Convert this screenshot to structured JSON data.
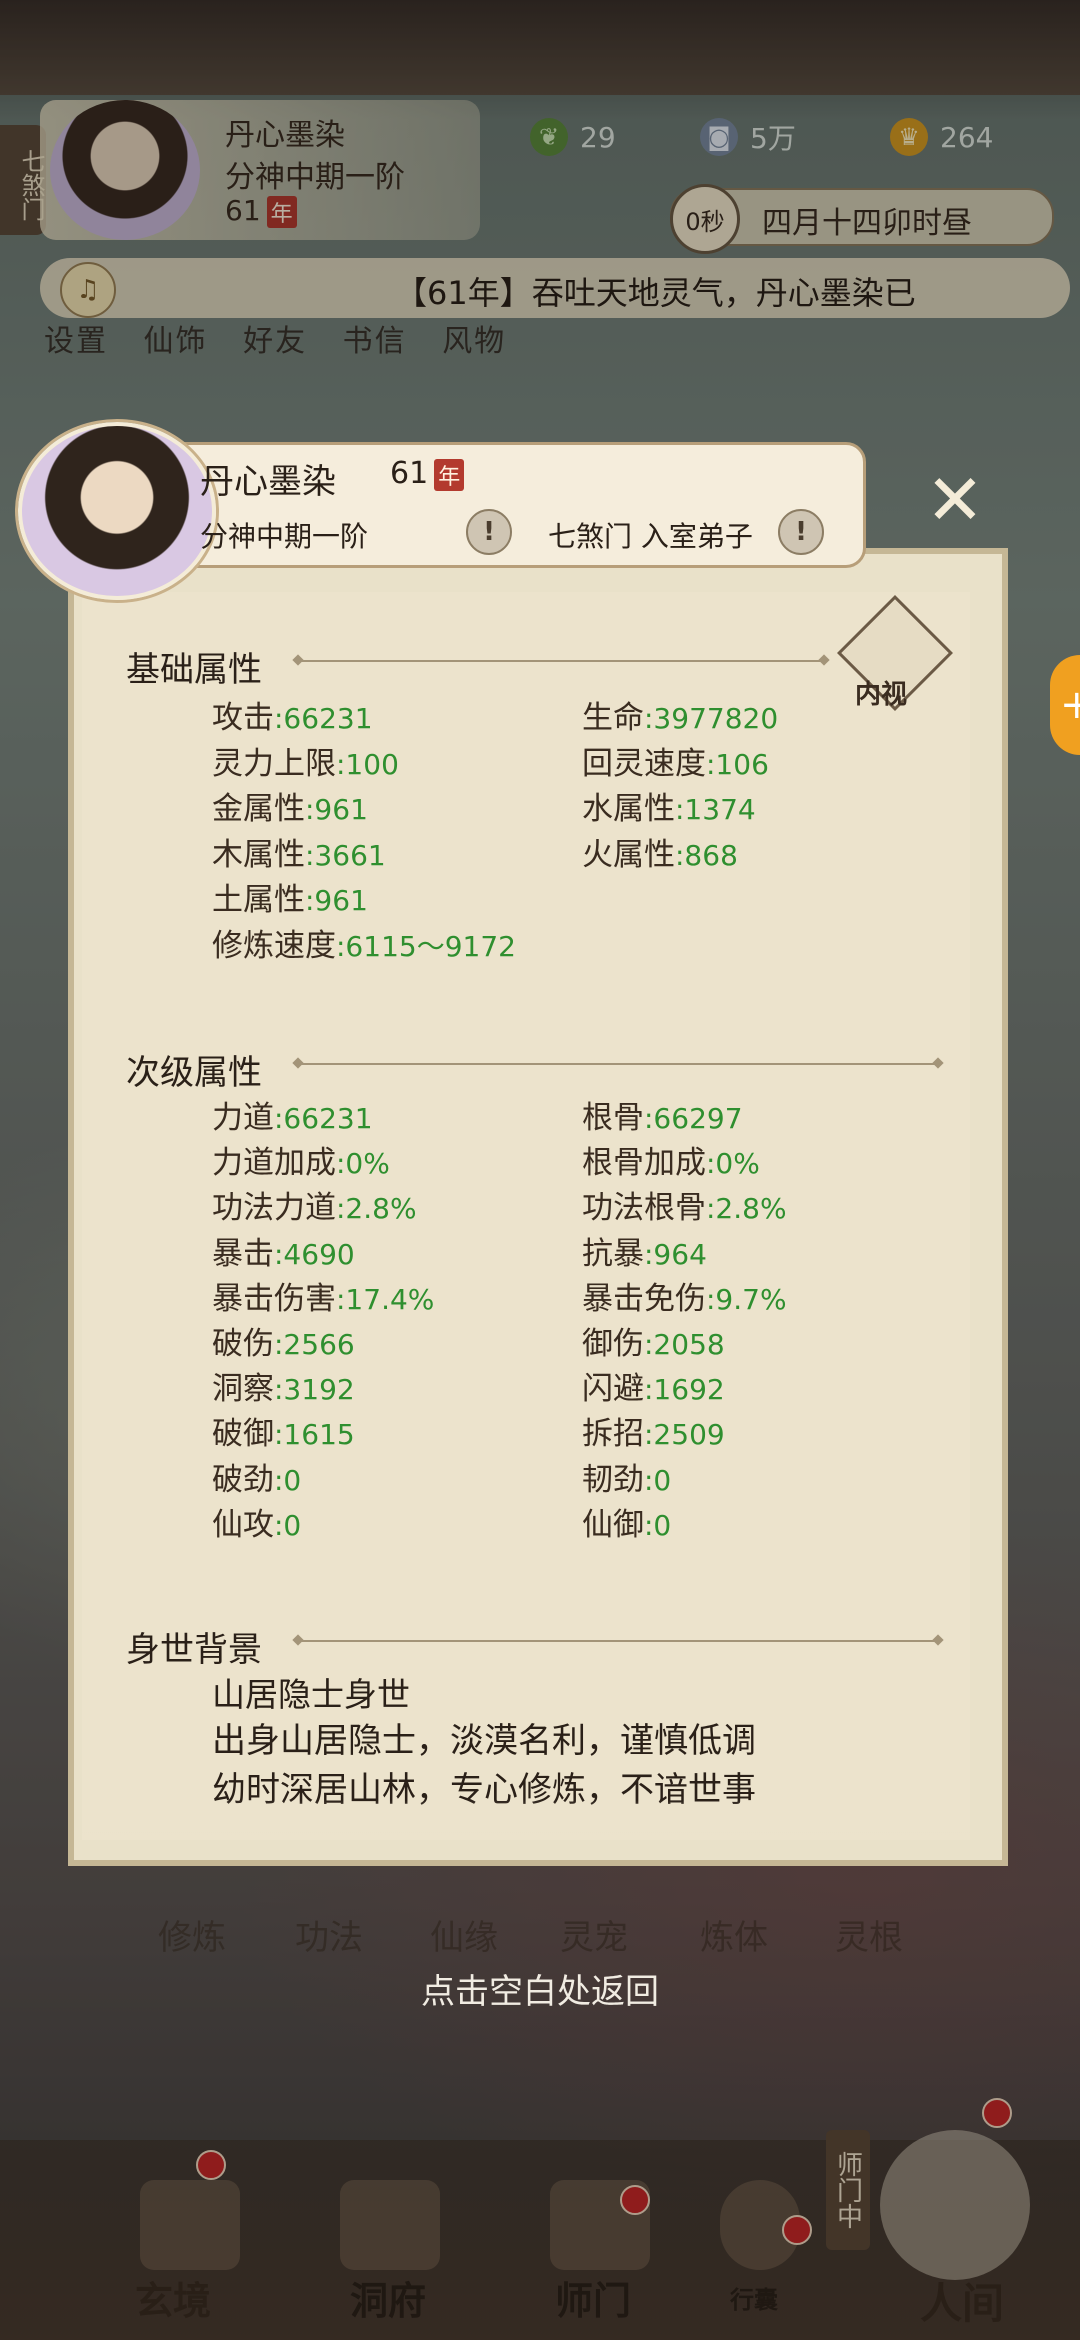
{
  "header": {
    "sect_tag": "七煞门",
    "name": "丹心墨染",
    "rank": "分神中期一阶",
    "age": "61",
    "age_badge": "年",
    "resources": [
      {
        "icon": "spirit-leaf-icon",
        "value": "29"
      },
      {
        "icon": "coin-icon",
        "value": "5万"
      },
      {
        "icon": "gold-ingot-icon",
        "value": "264"
      }
    ],
    "timer": "0秒",
    "date_text": "四月十四卯时昼",
    "news": "【61年】吞吐天地灵气，丹心墨染已",
    "menu": [
      "设置",
      "仙饰",
      "好友",
      "书信",
      "风物"
    ]
  },
  "profile": {
    "name": "丹心墨染",
    "age": "61",
    "age_badge": "年",
    "rank": "分神中期一阶",
    "sect_role": "七煞门 入室弟子",
    "inner_view_label": "内视",
    "basic": {
      "title": "基础属性",
      "stats": [
        {
          "label": "攻击",
          "value": ":66231"
        },
        {
          "label": "生命",
          "value": ":3977820"
        },
        {
          "label": "灵力上限",
          "value": ":100"
        },
        {
          "label": "回灵速度",
          "value": ":106"
        },
        {
          "label": "金属性",
          "value": ":961"
        },
        {
          "label": "水属性",
          "value": ":1374"
        },
        {
          "label": "木属性",
          "value": ":3661"
        },
        {
          "label": "火属性",
          "value": ":868"
        },
        {
          "label": "土属性",
          "value": ":961"
        },
        {
          "label": "修炼速度",
          "value": ":6115～9172"
        }
      ]
    },
    "secondary": {
      "title": "次级属性",
      "stats": [
        {
          "label": "力道",
          "value": ":66231"
        },
        {
          "label": "根骨",
          "value": ":66297"
        },
        {
          "label": "力道加成",
          "value": ":0%"
        },
        {
          "label": "根骨加成",
          "value": ":0%"
        },
        {
          "label": "功法力道",
          "value": ":2.8%"
        },
        {
          "label": "功法根骨",
          "value": ":2.8%"
        },
        {
          "label": "暴击",
          "value": ":4690"
        },
        {
          "label": "抗暴",
          "value": ":964"
        },
        {
          "label": "暴击伤害",
          "value": ":17.4%"
        },
        {
          "label": "暴击免伤",
          "value": ":9.7%"
        },
        {
          "label": "破伤",
          "value": ":2566"
        },
        {
          "label": "御伤",
          "value": ":2058"
        },
        {
          "label": "洞察",
          "value": ":3192"
        },
        {
          "label": "闪避",
          "value": ":1692"
        },
        {
          "label": "破御",
          "value": ":1615"
        },
        {
          "label": "拆招",
          "value": ":2509"
        },
        {
          "label": "破劲",
          "value": ":0"
        },
        {
          "label": "韧劲",
          "value": ":0"
        },
        {
          "label": "仙攻",
          "value": ":0"
        },
        {
          "label": "仙御",
          "value": ":0"
        }
      ]
    },
    "background": {
      "title": "身世背景",
      "lines": [
        "山居隐士身世",
        "出身山居隐士，淡漠名利，谨慎低调",
        "幼时深居山林，专心修炼，不谙世事"
      ]
    }
  },
  "functions": [
    "修炼",
    "功法",
    "仙缘",
    "灵宠",
    "炼体",
    "灵根"
  ],
  "return_hint": "点击空白处返回",
  "bottom_nav": {
    "items": [
      "玄境",
      "洞府",
      "师门",
      "行囊",
      "人间"
    ],
    "shimen_tag": "师门中"
  },
  "colors": {
    "value_green": "#2f8f2f",
    "panel_bg": "#ece3cc",
    "badge_red": "#b33a2e"
  }
}
